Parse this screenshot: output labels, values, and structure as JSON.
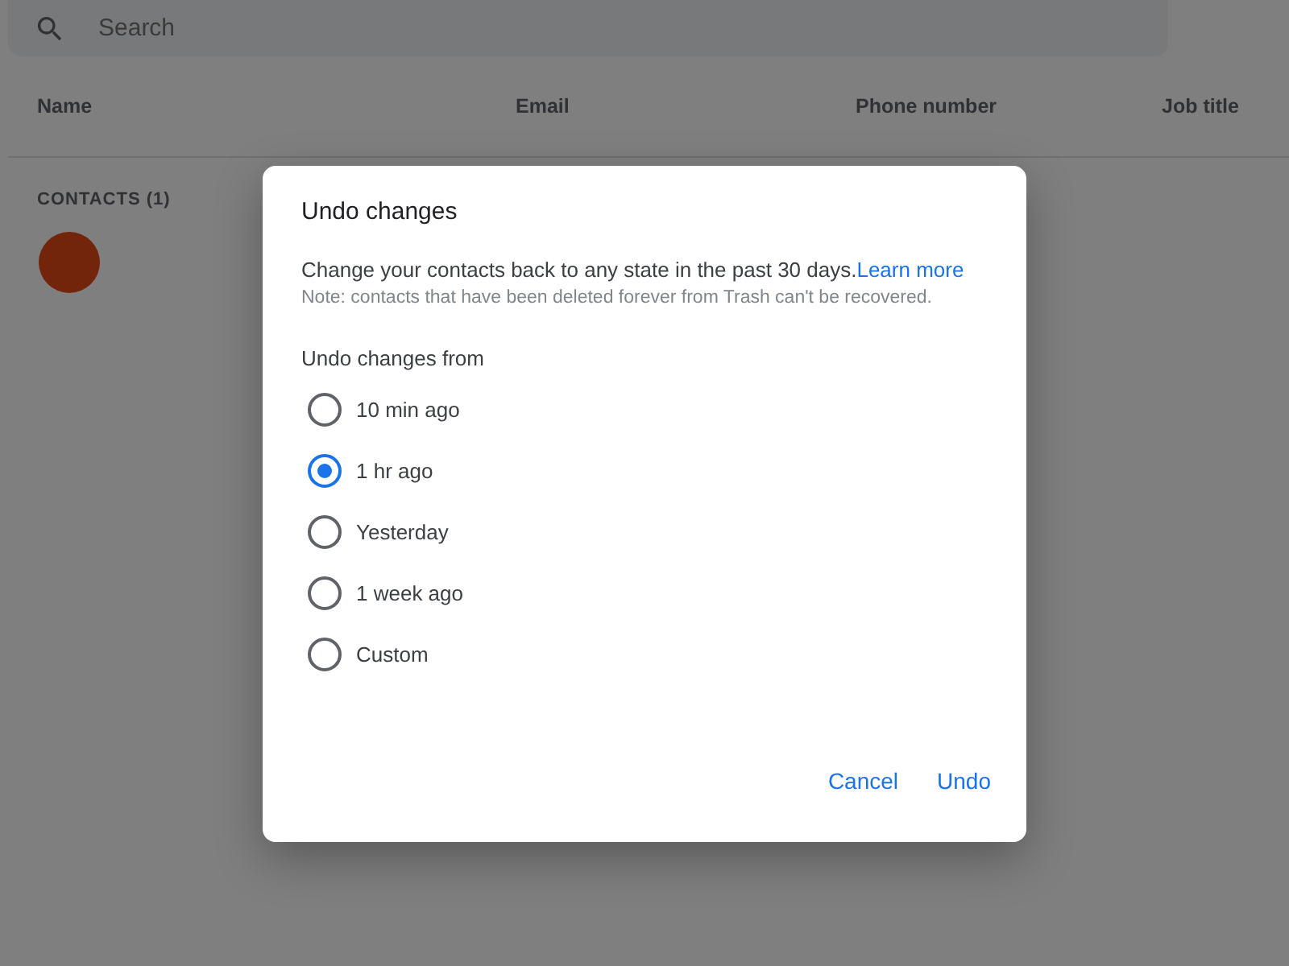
{
  "background": {
    "search": {
      "placeholder": "Search"
    },
    "columns": [
      "Name",
      "Email",
      "Phone number",
      "Job title"
    ],
    "section": "CONTACTS (1)"
  },
  "dialog": {
    "title": "Undo changes",
    "description": "Change your contacts back to any state in the past 30 days.",
    "link": "Learn more",
    "note": "Note: contacts that have been deleted forever from Trash can't be recovered.",
    "group_label": "Undo changes from",
    "options": [
      {
        "label": "10 min ago",
        "selected": false
      },
      {
        "label": "1 hr ago",
        "selected": true
      },
      {
        "label": "Yesterday",
        "selected": false
      },
      {
        "label": "1 week ago",
        "selected": false
      },
      {
        "label": "Custom",
        "selected": false
      }
    ],
    "buttons": [
      "Cancel",
      "Undo"
    ]
  }
}
